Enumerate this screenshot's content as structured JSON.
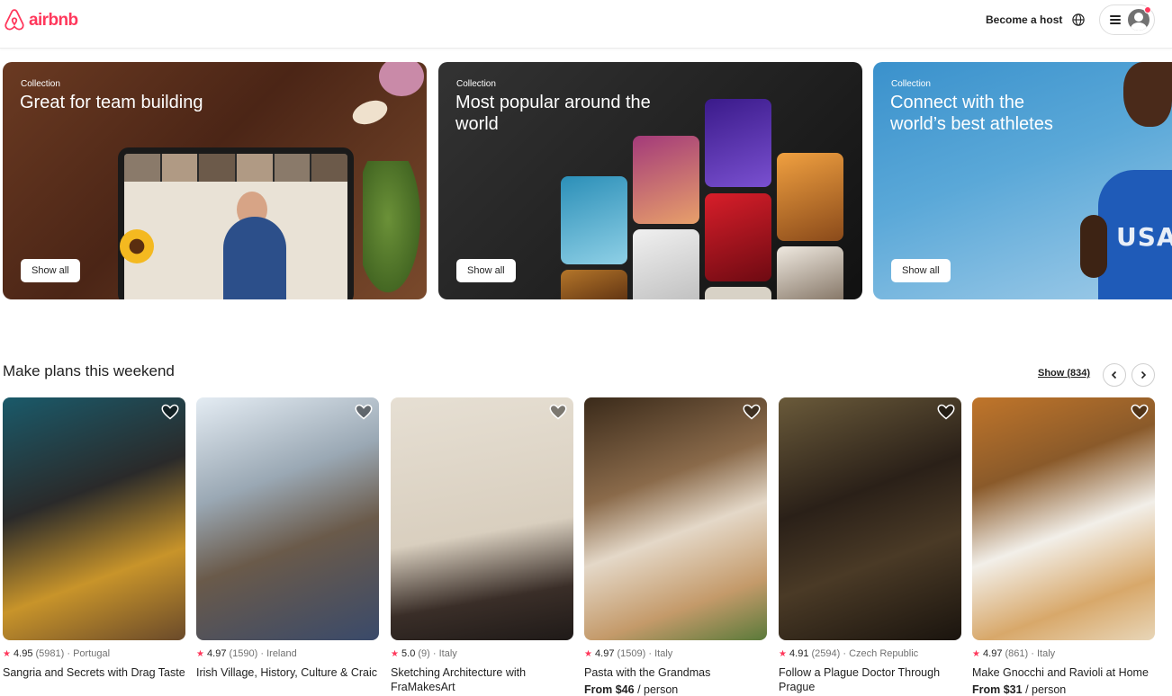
{
  "header": {
    "logo_text": "airbnb",
    "become_host": "Become a host"
  },
  "collections": [
    {
      "kicker": "Collection",
      "title": "Great for team building",
      "button": "Show all"
    },
    {
      "kicker": "Collection",
      "title": "Most popular around the world",
      "button": "Show all"
    },
    {
      "kicker": "Collection",
      "title": "Connect with the world’s best athletes",
      "button": "Show all"
    }
  ],
  "collection_art": {
    "athlete_shirt_text": "USA"
  },
  "section": {
    "title": "Make plans this weekend",
    "show_count": "Show (834)"
  },
  "cards": [
    {
      "rating": "4.95",
      "reviews": "(5981)",
      "location": "Portugal",
      "title": "Sangria and Secrets with Drag Taste",
      "price_from": "",
      "price_unit": ""
    },
    {
      "rating": "4.97",
      "reviews": "(1590)",
      "location": "Ireland",
      "title": "Irish Village, History, Culture & Craic",
      "price_from": "",
      "price_unit": ""
    },
    {
      "rating": "5.0",
      "reviews": "(9)",
      "location": "Italy",
      "title": "Sketching Architecture with FraMakesArt",
      "price_from": "",
      "price_unit": ""
    },
    {
      "rating": "4.97",
      "reviews": "(1509)",
      "location": "Italy",
      "title": "Pasta with the Grandmas",
      "price_from": "From $46",
      "price_unit": " / person"
    },
    {
      "rating": "4.91",
      "reviews": "(2594)",
      "location": "Czech Republic",
      "title": "Follow a Plague Doctor Through Prague",
      "price_from": "",
      "price_unit": ""
    },
    {
      "rating": "4.97",
      "reviews": "(861)",
      "location": "Italy",
      "title": "Make Gnocchi and Ravioli at Home",
      "price_from": "From $31",
      "price_unit": " / person"
    }
  ],
  "colors": {
    "brand": "#ff385c",
    "text": "#222222",
    "muted": "#717171"
  },
  "icons": [
    "airbnb-logo-icon",
    "globe-icon",
    "menu-icon",
    "avatar-icon",
    "chevron-left-icon",
    "chevron-right-icon",
    "heart-icon",
    "star-icon"
  ]
}
